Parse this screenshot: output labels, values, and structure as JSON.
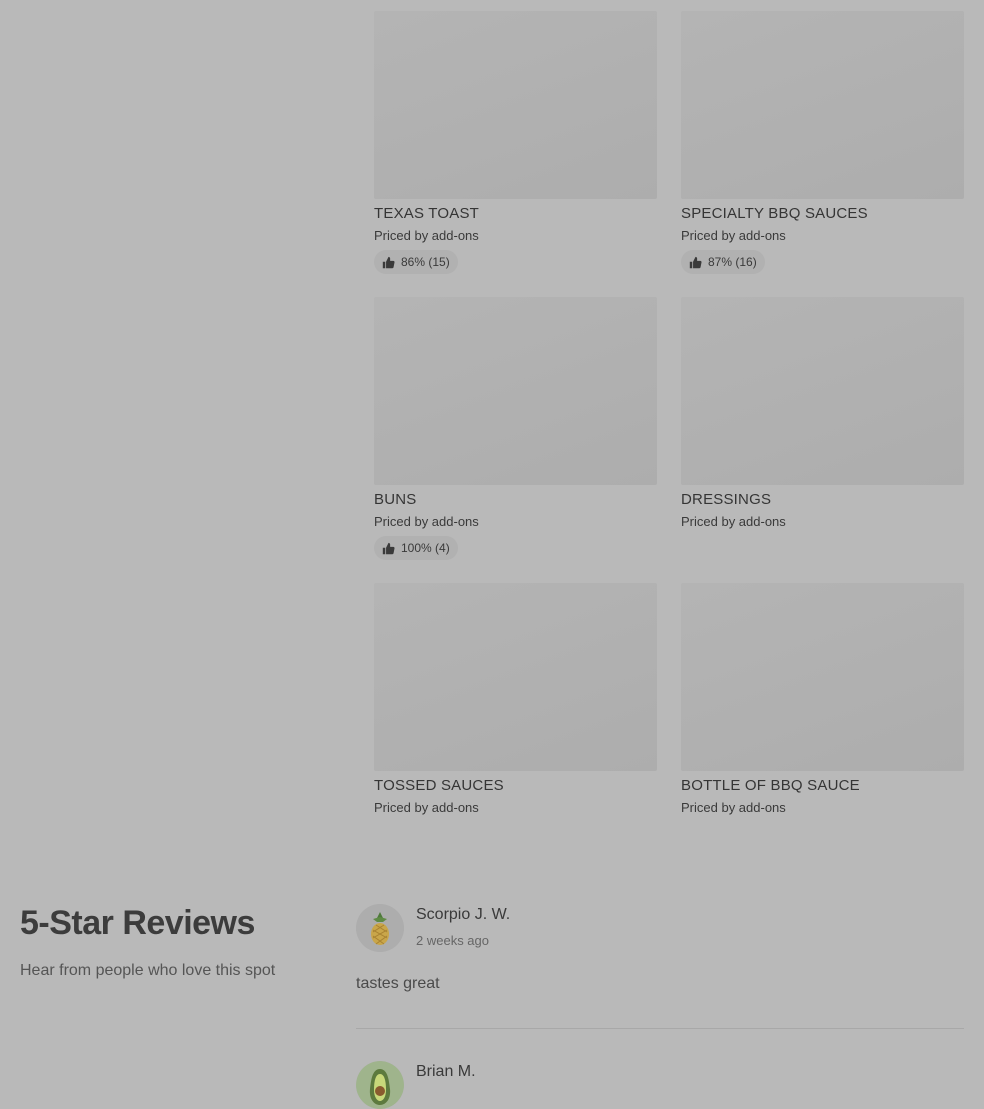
{
  "menu_items": [
    {
      "title": "TEXAS TOAST",
      "price": "Priced by add-ons",
      "rating": "86% (15)"
    },
    {
      "title": "SPECIALTY BBQ SAUCES",
      "price": "Priced by add-ons",
      "rating": "87% (16)"
    },
    {
      "title": "BUNS",
      "price": "Priced by add-ons",
      "rating": "100% (4)"
    },
    {
      "title": "DRESSINGS",
      "price": "Priced by add-ons",
      "rating": ""
    },
    {
      "title": "TOSSED SAUCES",
      "price": "Priced by add-ons",
      "rating": ""
    },
    {
      "title": "BOTTLE OF BBQ SAUCE",
      "price": "Priced by add-ons",
      "rating": ""
    }
  ],
  "reviews_section": {
    "heading": "5-Star Reviews",
    "subheading": "Hear from people who love this spot"
  },
  "reviews": [
    {
      "name": "Scorpio J. W.",
      "date": "2 weeks ago",
      "text": "tastes great",
      "avatar": "pineapple-icon"
    },
    {
      "name": "Brian M.",
      "date": "",
      "text": "",
      "avatar": "avocado-icon"
    }
  ],
  "colors": {
    "background": "#b9b9b9",
    "placeholder": "#b0b0b0"
  }
}
